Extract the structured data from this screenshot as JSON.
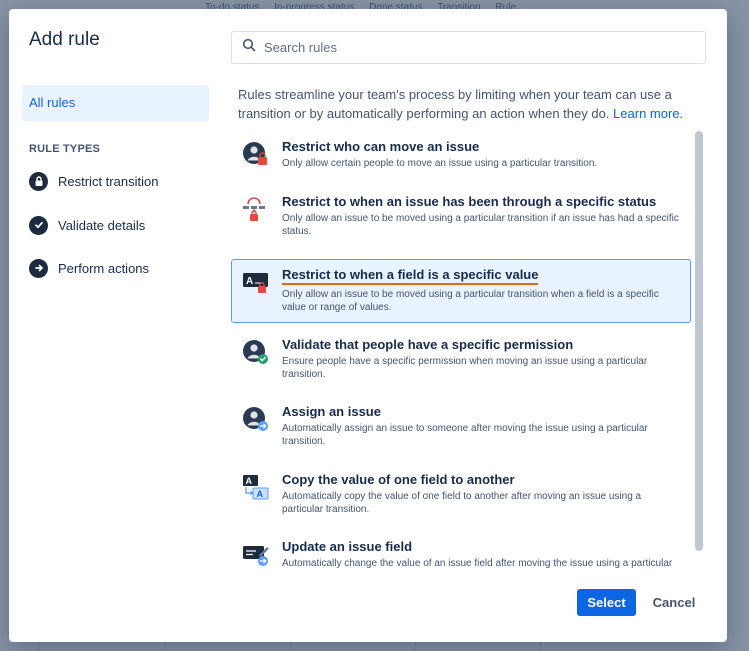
{
  "background": {
    "columns": [
      "To-do status",
      "In-progress status",
      "Done status",
      "Transition",
      "Rule"
    ]
  },
  "modal": {
    "title": "Add rule",
    "search": {
      "placeholder": "Search rules",
      "value": ""
    },
    "intro": {
      "text": "Rules streamline your team's process by limiting when your team can use a transition or by automatically performing an action when they do.",
      "link": "Learn more."
    },
    "sidebar": {
      "all_rules": "All rules",
      "heading": "RULE TYPES",
      "types": [
        {
          "label": "Restrict transition",
          "icon": "lock-icon"
        },
        {
          "label": "Validate details",
          "icon": "checkmark-icon"
        },
        {
          "label": "Perform actions",
          "icon": "arrow-right-icon"
        }
      ]
    },
    "rules": [
      {
        "title": "Restrict who can move an issue",
        "description": "Only allow certain people to move an issue using a particular transition.",
        "icon": "person-lock-icon"
      },
      {
        "title": "Restrict to when an issue has been through a specific status",
        "description": "Only allow an issue to be moved using a particular transition if an issue has had a specific status.",
        "icon": "status-path-lock-icon"
      },
      {
        "title": "Restrict to when a field is a specific value",
        "description": "Only allow an issue to be moved using a particular transition when a field is a specific value or range of values.",
        "icon": "field-lock-icon"
      },
      {
        "title": "Validate that people have a specific permission",
        "description": "Ensure people have a specific permission when moving an issue using a particular transition.",
        "icon": "person-check-icon"
      },
      {
        "title": "Assign an issue",
        "description": "Automatically assign an issue to someone after moving the issue using a particular transition.",
        "icon": "person-arrow-icon"
      },
      {
        "title": "Copy the value of one field to another",
        "description": "Automatically copy the value of one field to another after moving an issue using a particular transition.",
        "icon": "field-copy-icon"
      },
      {
        "title": "Update an issue field",
        "description": "Automatically change the value of an issue field after moving the issue using a particular transition.",
        "icon": "field-edit-icon"
      }
    ],
    "selected_rule_index": 2,
    "buttons": {
      "select": "Select",
      "cancel": "Cancel"
    }
  },
  "colors": {
    "accent": "#0c66e4",
    "selected_bg": "#e9f2ff",
    "lock_badge": "#e2483d",
    "check_badge": "#22a06b",
    "arrow_badge": "#579dff",
    "highlight_underline": "#e56910"
  }
}
